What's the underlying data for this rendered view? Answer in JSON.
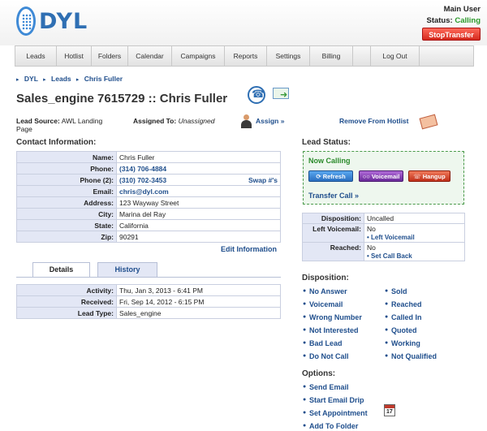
{
  "header": {
    "logo_text": "DYL",
    "user_name": "Main User",
    "status_label": "Status:",
    "status_value": "Calling",
    "stop_transfer_label": "StopTransfer"
  },
  "nav": {
    "items": [
      "Leads",
      "Hotlist",
      "Folders",
      "Calendar",
      "Campaigns",
      "Reports",
      "Settings",
      "Billing",
      "Log Out"
    ]
  },
  "breadcrumb": [
    "DYL",
    "Leads",
    "Chris Fuller"
  ],
  "title": "Sales_engine 7615729 :: Chris Fuller",
  "lead_source": {
    "label": "Lead Source:",
    "value": "AWL Landing Page"
  },
  "assigned_to": {
    "label": "Assigned To:",
    "value": "Unassigned",
    "assign_link": "Assign »"
  },
  "remove_hotlist": "Remove From Hotlist",
  "contact": {
    "header": "Contact Information:",
    "swap_label": "Swap #'s",
    "edit_label": "Edit Information",
    "rows": [
      {
        "label": "Name:",
        "value": "Chris Fuller"
      },
      {
        "label": "Phone:",
        "value": "(314) 706-4884"
      },
      {
        "label": "Phone (2):",
        "value": "(310) 702-3453"
      },
      {
        "label": "Email:",
        "value": "chris@dyl.com"
      },
      {
        "label": "Address:",
        "value": "123 Wayway Street"
      },
      {
        "label": "City:",
        "value": "Marina del Ray"
      },
      {
        "label": "State:",
        "value": "California"
      },
      {
        "label": "Zip:",
        "value": "90291"
      }
    ]
  },
  "tabs": {
    "details": "Details",
    "history": "History"
  },
  "details": {
    "rows": [
      {
        "label": "Activity:",
        "value": "Thu, Jan 3, 2013 - 6:41 PM"
      },
      {
        "label": "Received:",
        "value": "Fri, Sep 14, 2012 - 6:15 PM"
      },
      {
        "label": "Lead Type:",
        "value": "Sales_engine"
      }
    ]
  },
  "lead_status": {
    "header": "Lead Status:",
    "now_calling": "Now Calling",
    "refresh": "Refresh",
    "voicemail": "Voicemail",
    "hangup": "Hangup",
    "transfer": "Transfer Call »"
  },
  "status_table": {
    "disposition_label": "Disposition:",
    "disposition_value": "Uncalled",
    "left_vm_label": "Left Voicemail:",
    "left_vm_value": "No",
    "left_vm_link": "Left Voicemail",
    "reached_label": "Reached:",
    "reached_value": "No",
    "reached_link": "Set Call Back"
  },
  "disposition": {
    "header": "Disposition:",
    "left": [
      "No Answer",
      "Voicemail",
      "Wrong Number",
      "Not Interested",
      "Bad Lead",
      "Do Not Call"
    ],
    "right": [
      "Sold",
      "Reached",
      "Called In",
      "Quoted",
      "Working",
      "Not Qualified"
    ]
  },
  "options": {
    "header": "Options:",
    "items": [
      "Send Email",
      "Start Email Drip",
      "Set Appointment",
      "Add To Folder"
    ],
    "calendar_day": "17"
  },
  "colors": {
    "brand": "#2f6fb3",
    "link": "#1f4e8c",
    "calling": "#2a9a2a",
    "stop": "#d42a1e"
  }
}
